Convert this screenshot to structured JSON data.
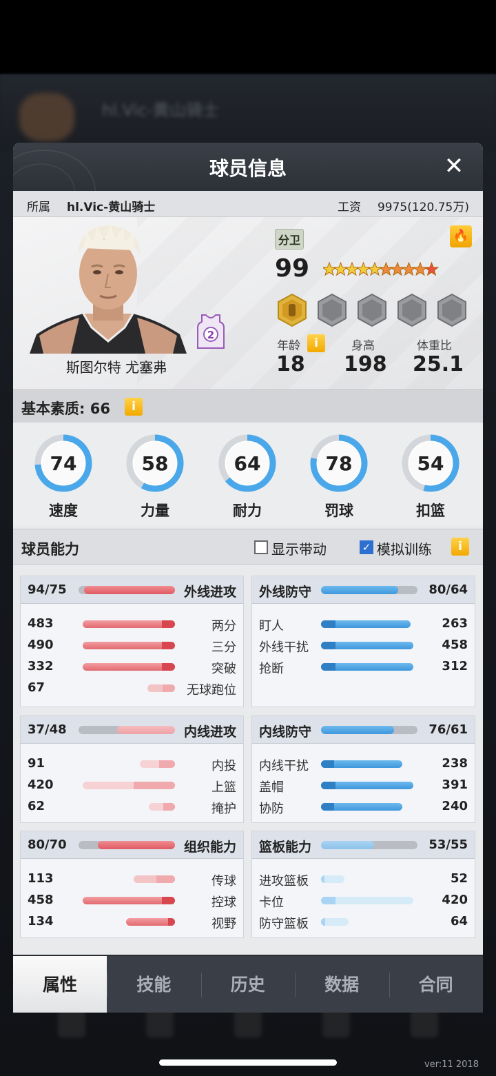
{
  "panel": {
    "title": "球员信息",
    "close": "✕"
  },
  "team": {
    "label": "所属",
    "name": "hl.Vic-黄山骑士",
    "salary_label": "工资",
    "salary": "9975(120.75万)"
  },
  "player": {
    "name": "斯图尔特 尤塞弗",
    "jersey_number": "2",
    "position": "分卫",
    "overall": "99",
    "stars": 10,
    "age_label": "年龄",
    "age": "18",
    "height_label": "身高",
    "height": "198",
    "weight_label": "体重比",
    "weight": "25.1",
    "info": "i",
    "fire_icon": "flame-icon"
  },
  "basic": {
    "title": "基本素质: 66",
    "info": "i",
    "stats": [
      {
        "label": "速度",
        "value": "74"
      },
      {
        "label": "力量",
        "value": "58"
      },
      {
        "label": "耐力",
        "value": "64"
      },
      {
        "label": "罚球",
        "value": "78"
      },
      {
        "label": "扣篮",
        "value": "54"
      }
    ]
  },
  "ability": {
    "title": "球员能力",
    "show_drive": "显示带动",
    "show_drive_checked": false,
    "sim_train": "模拟训练",
    "sim_train_checked": true,
    "info": "i"
  },
  "cards": [
    {
      "title": "外线进攻",
      "score": "94/75",
      "side": "left",
      "fill": 0.94,
      "color": "red",
      "rows": [
        {
          "n": "两分",
          "v": "483",
          "f": 1.0
        },
        {
          "n": "三分",
          "v": "490",
          "f": 1.0
        },
        {
          "n": "突破",
          "v": "332",
          "f": 1.0
        },
        {
          "n": "无球跑位",
          "v": "67",
          "f": 0.3
        }
      ]
    },
    {
      "title": "外线防守",
      "score": "80/64",
      "side": "right",
      "fill": 0.8,
      "color": "blue",
      "rows": [
        {
          "n": "盯人",
          "v": "263",
          "f": 0.97
        },
        {
          "n": "外线干扰",
          "v": "458",
          "f": 1.0
        },
        {
          "n": "抢断",
          "v": "312",
          "f": 1.0
        }
      ]
    },
    {
      "title": "内线进攻",
      "score": "37/48",
      "side": "left",
      "fill": 0.6,
      "color": "pink",
      "rows": [
        {
          "n": "内投",
          "v": "91",
          "f": 0.38
        },
        {
          "n": "上篮",
          "v": "420",
          "f": 1.0
        },
        {
          "n": "掩护",
          "v": "62",
          "f": 0.28
        }
      ]
    },
    {
      "title": "内线防守",
      "score": "76/61",
      "side": "right",
      "fill": 0.76,
      "color": "blue",
      "rows": [
        {
          "n": "内线干扰",
          "v": "238",
          "f": 0.88
        },
        {
          "n": "盖帽",
          "v": "391",
          "f": 1.0
        },
        {
          "n": "协防",
          "v": "240",
          "f": 0.88
        }
      ]
    },
    {
      "title": "组织能力",
      "score": "80/70",
      "side": "left",
      "fill": 0.8,
      "color": "red",
      "rows": [
        {
          "n": "传球",
          "v": "113",
          "f": 0.45
        },
        {
          "n": "控球",
          "v": "458",
          "f": 1.0
        },
        {
          "n": "视野",
          "v": "134",
          "f": 0.53
        }
      ]
    },
    {
      "title": "篮板能力",
      "score": "53/55",
      "side": "right",
      "fill": 0.55,
      "color": "lightblue",
      "rows": [
        {
          "n": "进攻篮板",
          "v": "52",
          "f": 0.25
        },
        {
          "n": "卡位",
          "v": "420",
          "f": 1.0
        },
        {
          "n": "防守篮板",
          "v": "64",
          "f": 0.3
        }
      ]
    }
  ],
  "tabs": [
    "属性",
    "技能",
    "历史",
    "数据",
    "合同"
  ],
  "active_tab": 0,
  "version": "ver:11  2018"
}
